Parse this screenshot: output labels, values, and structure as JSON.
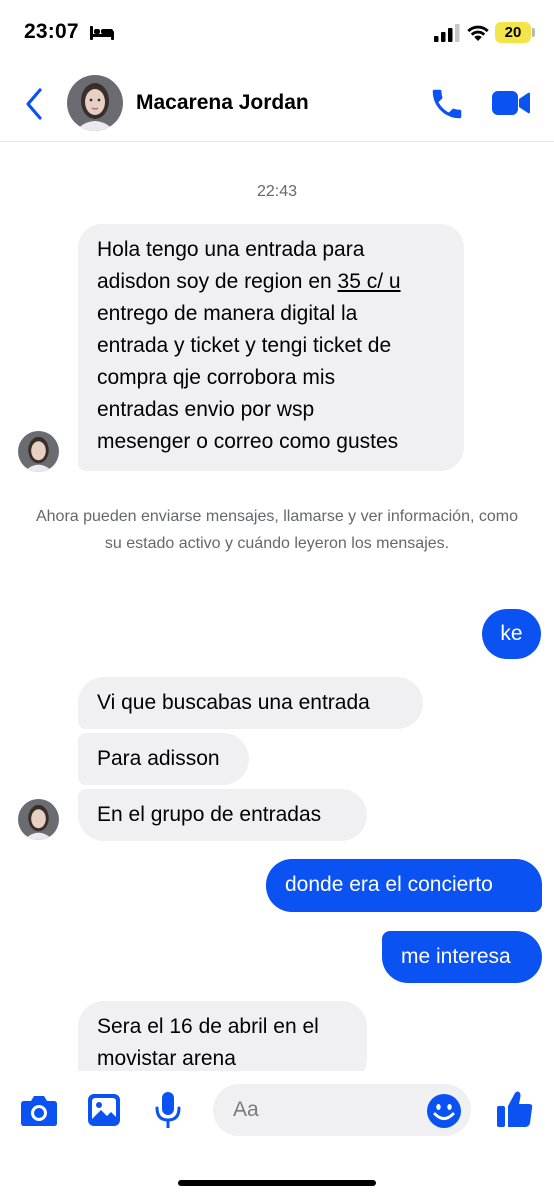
{
  "status_bar": {
    "time": "23:07",
    "battery": "20"
  },
  "header": {
    "contact_name": "Macarena Jordan"
  },
  "chat": {
    "timestamp": "22:43",
    "first_message": {
      "lines": [
        "Hola tengo una entrada para",
        "adisdon soy de region en",
        "35 c/ u",
        "entrego de manera  digital la",
        "entrada y ticket y tengi ticket de",
        "compra qje corrobora mis",
        "entradas envio por wsp",
        "mesenger o correo como gustes"
      ]
    },
    "system_notice": "Ahora pueden enviarse mensajes, llamarse y ver información, como su estado activo y cuándo leyeron los mensajes.",
    "messages": [
      {
        "from": "me",
        "text": "ke"
      },
      {
        "from": "them",
        "text": "Vi que buscabas una entrada"
      },
      {
        "from": "them",
        "text": "Para adisson"
      },
      {
        "from": "them",
        "text": "En el grupo de entradas"
      },
      {
        "from": "me",
        "text": "donde era el concierto"
      },
      {
        "from": "me",
        "text": "me interesa"
      },
      {
        "from": "them",
        "text": "Sera el 16 de abril en el movistar arena"
      }
    ]
  },
  "composer": {
    "placeholder": "Aa"
  },
  "colors": {
    "accent": "#0a52f2",
    "incoming_bubble": "#f0f0f2",
    "meta_text": "#65676b"
  }
}
